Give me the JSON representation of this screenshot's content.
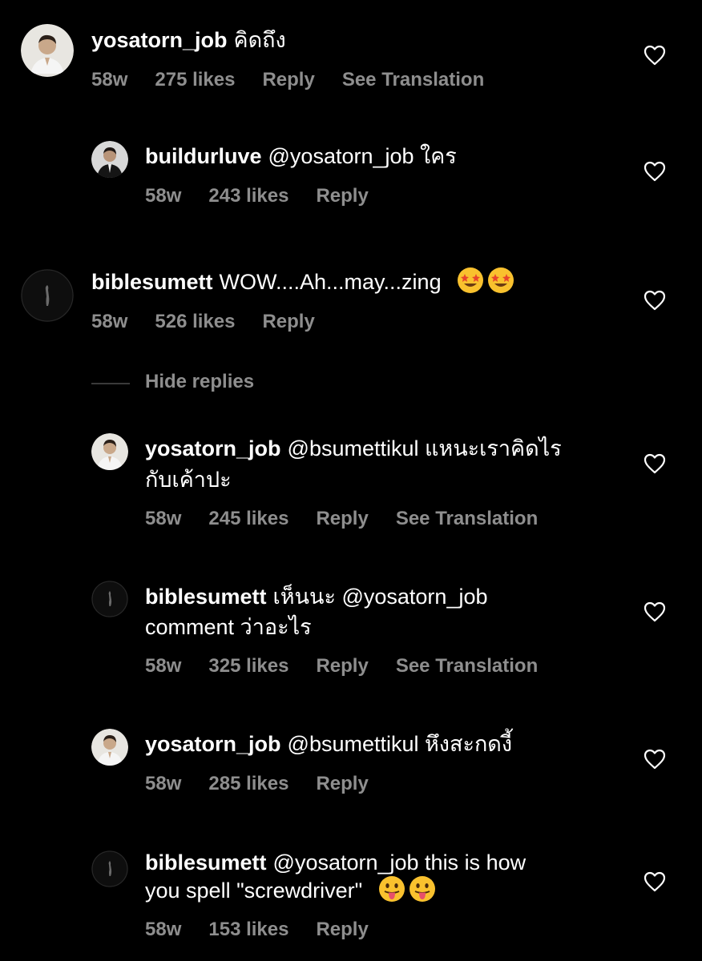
{
  "comments": [
    {
      "username": "yosatorn_job",
      "text": "คิดถึง",
      "age": "58w",
      "likes": "275 likes",
      "reply": "Reply",
      "translate": "See Translation"
    },
    {
      "username": "buildurluve",
      "text": "@yosatorn_job ใคร",
      "age": "58w",
      "likes": "243 likes",
      "reply": "Reply"
    },
    {
      "username": "biblesumett",
      "text": "WOW....Ah...may...zing",
      "emoji": "🤩",
      "age": "58w",
      "likes": "526 likes",
      "reply": "Reply"
    },
    {
      "username": "yosatorn_job",
      "text_line1": "@bsumettikul แหนะเราคิดไร",
      "text_line2": "กับเค้าปะ",
      "age": "58w",
      "likes": "245 likes",
      "reply": "Reply",
      "translate": "See Translation"
    },
    {
      "username": "biblesumett",
      "text_line1": "เห็นนะ @yosatorn_job",
      "text_line2": "comment ว่าอะไร",
      "age": "58w",
      "likes": "325 likes",
      "reply": "Reply",
      "translate": "See Translation"
    },
    {
      "username": "yosatorn_job",
      "text": "@bsumettikul หึงสะกดงี้",
      "age": "58w",
      "likes": "285 likes",
      "reply": "Reply"
    },
    {
      "username": "biblesumett",
      "text_line1": "@yosatorn_job this is how",
      "text_line2": "you spell \"screwdriver\"",
      "emoji": "😛",
      "age": "58w",
      "likes": "153 likes",
      "reply": "Reply"
    }
  ],
  "hide_replies": "Hide replies",
  "colors": {
    "background": "#000000",
    "text": "#ffffff",
    "meta": "#8e8e8e"
  }
}
